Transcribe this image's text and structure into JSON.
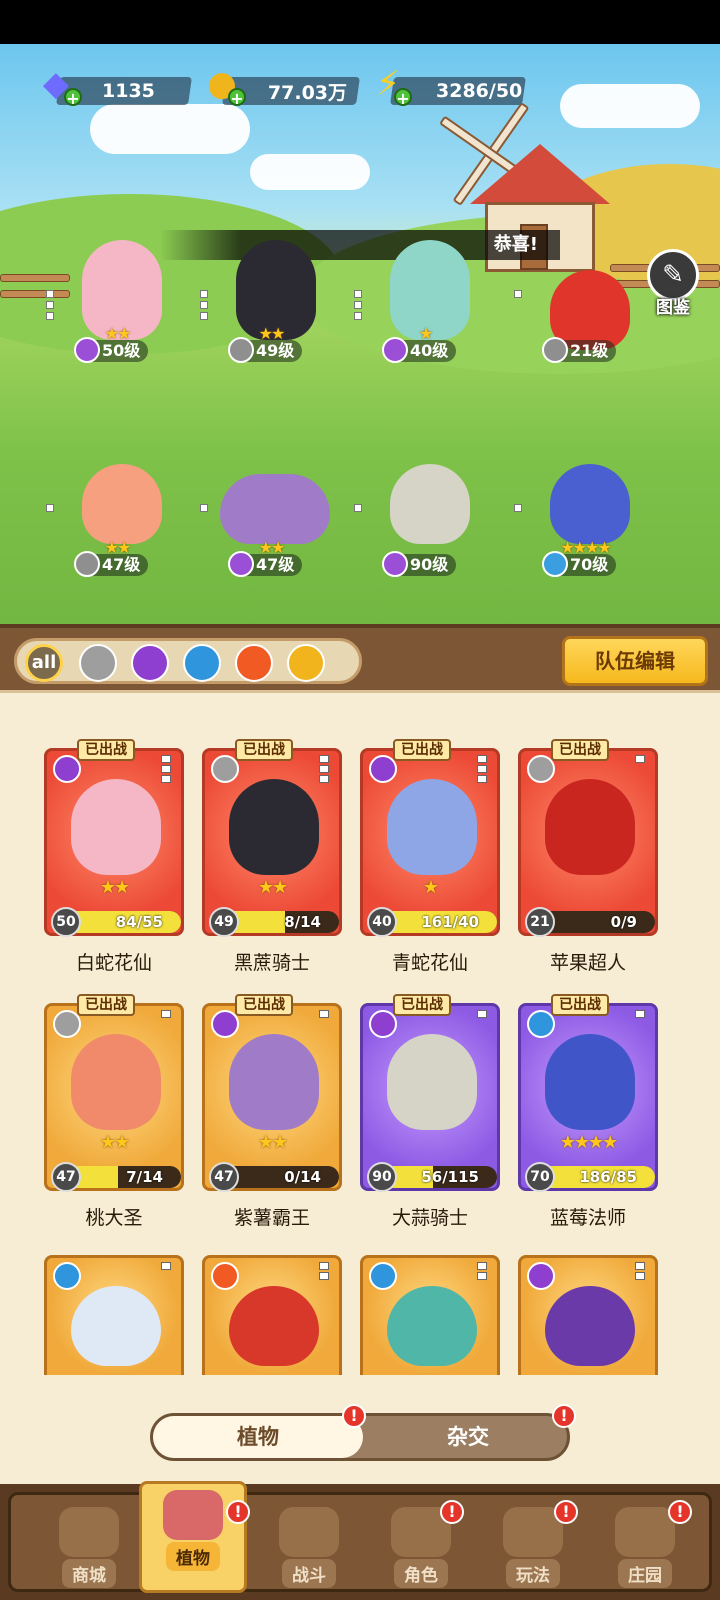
{
  "resources": {
    "gems": "1135",
    "coins": "77.03万",
    "energy": "3286/50"
  },
  "scene": {
    "congrats": "恭喜!",
    "codex_label": "图鉴",
    "units": [
      {
        "level": "50级",
        "stars": "★★",
        "element": "poison"
      },
      {
        "level": "49级",
        "stars": "★★",
        "element": "sword"
      },
      {
        "level": "40级",
        "stars": "★",
        "element": "poison"
      },
      {
        "level": "21级",
        "stars": "",
        "element": "sword"
      },
      {
        "level": "47级",
        "stars": "★★",
        "element": "sword"
      },
      {
        "level": "47级",
        "stars": "★★",
        "element": "poison"
      },
      {
        "level": "90级",
        "stars": "",
        "element": "poison"
      },
      {
        "level": "70级",
        "stars": "★★★★",
        "element": "water"
      }
    ]
  },
  "filters": {
    "all": "all",
    "icons": [
      "sword-icon",
      "poison-icon",
      "water-icon",
      "fire-icon",
      "lightning-icon"
    ]
  },
  "team_edit": "队伍编辑",
  "deployed_badge": "已出战",
  "cards": [
    {
      "name": "白蛇花仙",
      "level": "50",
      "progress": "84/55",
      "fill": 1.0,
      "stars": "★★",
      "color": "red"
    },
    {
      "name": "黑蔗骑士",
      "level": "49",
      "progress": "8/14",
      "fill": 0.57,
      "stars": "★★",
      "color": "red"
    },
    {
      "name": "青蛇花仙",
      "level": "40",
      "progress": "161/40",
      "fill": 1.0,
      "stars": "★",
      "color": "red"
    },
    {
      "name": "苹果超人",
      "level": "21",
      "progress": "0/9",
      "fill": 0.0,
      "stars": "",
      "color": "red"
    },
    {
      "name": "桃大圣",
      "level": "47",
      "progress": "7/14",
      "fill": 0.5,
      "stars": "★★",
      "color": "gold"
    },
    {
      "name": "紫薯霸王",
      "level": "47",
      "progress": "0/14",
      "fill": 0.0,
      "stars": "★★",
      "color": "gold"
    },
    {
      "name": "大蒜骑士",
      "level": "90",
      "progress": "56/115",
      "fill": 0.49,
      "stars": "",
      "color": "purple"
    },
    {
      "name": "蓝莓法师",
      "level": "70",
      "progress": "186/85",
      "fill": 1.0,
      "stars": "★★★★",
      "color": "purple"
    }
  ],
  "toggle": {
    "left": "植物",
    "right": "杂交"
  },
  "nav": {
    "items": [
      "商城",
      "植物",
      "战斗",
      "角色",
      "玩法",
      "庄园"
    ],
    "active": "植物"
  },
  "colors": {
    "accent": "#f6b91d",
    "alert": "#e5352a"
  }
}
